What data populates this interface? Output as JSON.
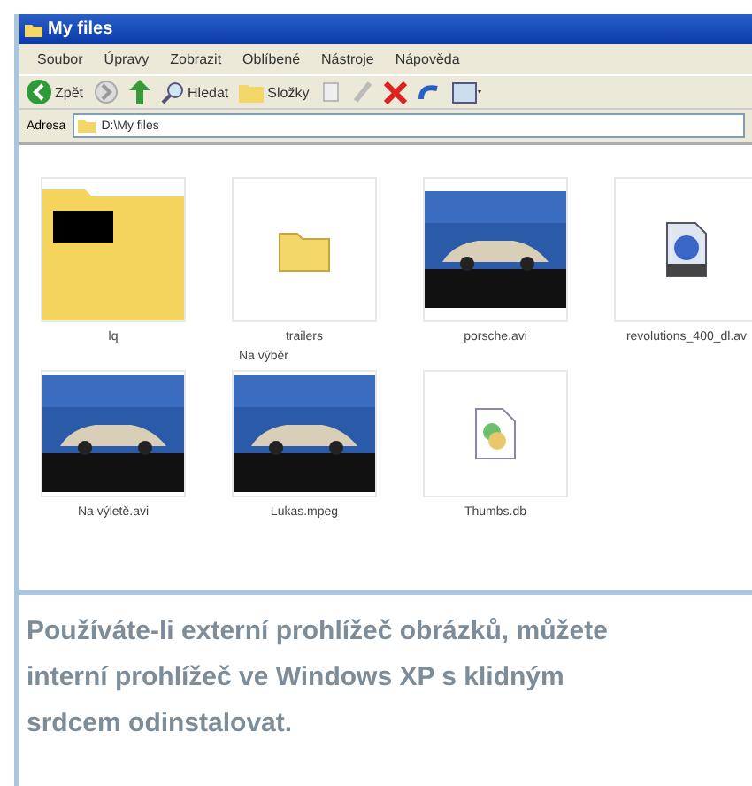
{
  "window": {
    "title": "My files"
  },
  "menu": [
    "Soubor",
    "Úpravy",
    "Zobrazit",
    "Oblíbené",
    "Nástroje",
    "Nápověda"
  ],
  "toolbar": {
    "back": "Zpět",
    "search": "Hledat",
    "folders": "Složky"
  },
  "address": {
    "label": "Adresa",
    "value": "D:\\My files"
  },
  "files": [
    {
      "name": "lq",
      "kind": "folder-preview"
    },
    {
      "name": "trailers",
      "kind": "folder"
    },
    {
      "name": "porsche.avi",
      "kind": "picture"
    },
    {
      "name": "revolutions_400_dl.av",
      "kind": "video"
    },
    {
      "name": "Na výletě.avi",
      "kind": "picture"
    },
    {
      "name": "Lukas.mpeg",
      "kind": "picture"
    },
    {
      "name": "Thumbs.db",
      "kind": "file"
    }
  ],
  "group_label": "Na výběr",
  "caption": "Používáte-li externí prohlížeč obrázků, můžete interní prohlížeč ve Windows XP s klidným srdcem odinstalovat."
}
